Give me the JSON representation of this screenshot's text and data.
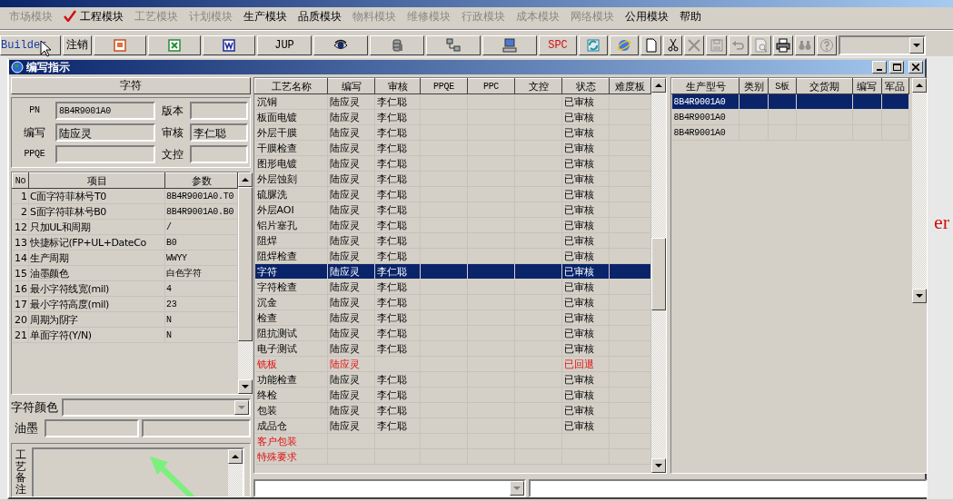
{
  "menu": [
    {
      "label": "市场模块",
      "disabled": true,
      "checked": false
    },
    {
      "label": "工程模块",
      "disabled": false,
      "checked": true
    },
    {
      "label": "工艺模块",
      "disabled": true,
      "checked": false
    },
    {
      "label": "计划模块",
      "disabled": true,
      "checked": false
    },
    {
      "label": "生产模块",
      "disabled": false,
      "checked": false
    },
    {
      "label": "品质模块",
      "disabled": false,
      "checked": false
    },
    {
      "label": "物料模块",
      "disabled": true,
      "checked": false
    },
    {
      "label": "维修模块",
      "disabled": true,
      "checked": false
    },
    {
      "label": "行政模块",
      "disabled": true,
      "checked": false
    },
    {
      "label": "成本模块",
      "disabled": true,
      "checked": false
    },
    {
      "label": "网络模块",
      "disabled": true,
      "checked": false
    },
    {
      "label": "公用模块",
      "disabled": false,
      "checked": false
    },
    {
      "label": "帮助",
      "disabled": false,
      "checked": false
    }
  ],
  "toolbar": [
    {
      "kind": "text",
      "label": "Builder",
      "color": "#1a3aa0"
    },
    {
      "kind": "text",
      "label": "注销",
      "color": "#000000"
    },
    {
      "kind": "icon",
      "disabled": false
    },
    {
      "kind": "icon",
      "disabled": false
    },
    {
      "kind": "icon",
      "disabled": false
    },
    {
      "kind": "text",
      "label": "JUP",
      "color": "#000000"
    },
    {
      "kind": "icon",
      "disabled": false
    },
    {
      "kind": "icon",
      "disabled": false
    },
    {
      "kind": "icon",
      "disabled": false
    },
    {
      "kind": "icon",
      "disabled": false
    },
    {
      "kind": "text",
      "label": "SPC",
      "color": "#d01010"
    },
    {
      "kind": "icon",
      "disabled": false
    },
    {
      "kind": "icon",
      "disabled": false
    },
    {
      "kind": "icon",
      "disabled": false
    },
    {
      "kind": "icon",
      "disabled": false
    },
    {
      "kind": "icon",
      "disabled": true
    },
    {
      "kind": "icon",
      "disabled": true
    },
    {
      "kind": "icon",
      "disabled": true
    },
    {
      "kind": "icon",
      "disabled": true
    },
    {
      "kind": "icon",
      "disabled": false
    },
    {
      "kind": "icon",
      "disabled": true
    },
    {
      "kind": "icon",
      "disabled": true
    },
    {
      "kind": "combo"
    }
  ],
  "window": {
    "title": "编写指示"
  },
  "detail": {
    "header": "字符",
    "fields": [
      {
        "label": "PN",
        "value": "8B4R9001A0"
      },
      {
        "label": "版本"
      },
      {
        "label": "编写",
        "value": "陆应灵"
      },
      {
        "label": "审核",
        "value": "李仁聪"
      },
      {
        "label": "PPQE"
      },
      {
        "label": "文控"
      }
    ],
    "params": {
      "columns": [
        "No",
        "项目",
        "参数"
      ],
      "rows": [
        [
          "1",
          "C面字符菲林号T0",
          "8B4R9001A0.T0"
        ],
        [
          "2",
          "S面字符菲林号B0",
          "8B4R9001A0.B0"
        ],
        [
          "12",
          "只加UL和周期",
          "/"
        ],
        [
          "13",
          "快捷标记(FP+UL+DateCo",
          "B0"
        ],
        [
          "14",
          "生产周期",
          "WWYY"
        ],
        [
          "15",
          "油墨颜色",
          "白色字符"
        ],
        [
          "16",
          "最小字符线宽(mil)",
          "4"
        ],
        [
          "17",
          "最小字符高度(mil)",
          "23"
        ],
        [
          "20",
          "周期为阴字",
          "N"
        ],
        [
          "21",
          "单面字符(Y/N)",
          "N"
        ]
      ]
    },
    "color_label": "字符颜色",
    "ink_label": "油墨",
    "notes_label": "工艺备注"
  },
  "process_table": {
    "columns": [
      "工艺名称",
      "编写",
      "审核",
      "PPQE",
      "PPC",
      "文控",
      "状态",
      "难度板"
    ],
    "rows": [
      {
        "cells": [
          "沉铜",
          "陆应灵",
          "李仁聪",
          "",
          "",
          "",
          "已审核",
          ""
        ],
        "selected": false,
        "alert": false
      },
      {
        "cells": [
          "板面电镀",
          "陆应灵",
          "李仁聪",
          "",
          "",
          "",
          "已审核",
          ""
        ],
        "selected": false,
        "alert": false
      },
      {
        "cells": [
          "外层干膜",
          "陆应灵",
          "李仁聪",
          "",
          "",
          "",
          "已审核",
          ""
        ],
        "selected": false,
        "alert": false
      },
      {
        "cells": [
          "干膜检查",
          "陆应灵",
          "李仁聪",
          "",
          "",
          "",
          "已审核",
          ""
        ],
        "selected": false,
        "alert": false
      },
      {
        "cells": [
          "图形电镀",
          "陆应灵",
          "李仁聪",
          "",
          "",
          "",
          "已审核",
          ""
        ],
        "selected": false,
        "alert": false
      },
      {
        "cells": [
          "外层蚀刻",
          "陆应灵",
          "李仁聪",
          "",
          "",
          "",
          "已审核",
          ""
        ],
        "selected": false,
        "alert": false
      },
      {
        "cells": [
          "硫脲洗",
          "陆应灵",
          "李仁聪",
          "",
          "",
          "",
          "已审核",
          ""
        ],
        "selected": false,
        "alert": false
      },
      {
        "cells": [
          "外层AOI",
          "陆应灵",
          "李仁聪",
          "",
          "",
          "",
          "已审核",
          ""
        ],
        "selected": false,
        "alert": false
      },
      {
        "cells": [
          "铝片塞孔",
          "陆应灵",
          "李仁聪",
          "",
          "",
          "",
          "已审核",
          ""
        ],
        "selected": false,
        "alert": false
      },
      {
        "cells": [
          "阻焊",
          "陆应灵",
          "李仁聪",
          "",
          "",
          "",
          "已审核",
          ""
        ],
        "selected": false,
        "alert": false
      },
      {
        "cells": [
          "阻焊检查",
          "陆应灵",
          "李仁聪",
          "",
          "",
          "",
          "已审核",
          ""
        ],
        "selected": false,
        "alert": false
      },
      {
        "cells": [
          "字符",
          "陆应灵",
          "李仁聪",
          "",
          "",
          "",
          "已审核",
          ""
        ],
        "selected": true,
        "alert": false
      },
      {
        "cells": [
          "字符检查",
          "陆应灵",
          "李仁聪",
          "",
          "",
          "",
          "已审核",
          ""
        ],
        "selected": false,
        "alert": false
      },
      {
        "cells": [
          "沉金",
          "陆应灵",
          "李仁聪",
          "",
          "",
          "",
          "已审核",
          ""
        ],
        "selected": false,
        "alert": false
      },
      {
        "cells": [
          "检查",
          "陆应灵",
          "李仁聪",
          "",
          "",
          "",
          "已审核",
          ""
        ],
        "selected": false,
        "alert": false
      },
      {
        "cells": [
          "阻抗测试",
          "陆应灵",
          "李仁聪",
          "",
          "",
          "",
          "已审核",
          ""
        ],
        "selected": false,
        "alert": false
      },
      {
        "cells": [
          "电子测试",
          "陆应灵",
          "李仁聪",
          "",
          "",
          "",
          "已审核",
          ""
        ],
        "selected": false,
        "alert": false
      },
      {
        "cells": [
          "铣板",
          "陆应灵",
          "",
          "",
          "",
          "",
          "已回退",
          ""
        ],
        "selected": false,
        "alert": true
      },
      {
        "cells": [
          "功能检查",
          "陆应灵",
          "李仁聪",
          "",
          "",
          "",
          "已审核",
          ""
        ],
        "selected": false,
        "alert": false
      },
      {
        "cells": [
          "终检",
          "陆应灵",
          "李仁聪",
          "",
          "",
          "",
          "已审核",
          ""
        ],
        "selected": false,
        "alert": false
      },
      {
        "cells": [
          "包装",
          "陆应灵",
          "李仁聪",
          "",
          "",
          "",
          "已审核",
          ""
        ],
        "selected": false,
        "alert": false
      },
      {
        "cells": [
          "成品仓",
          "陆应灵",
          "李仁聪",
          "",
          "",
          "",
          "已审核",
          ""
        ],
        "selected": false,
        "alert": false
      },
      {
        "cells": [
          "客户包装",
          "",
          "",
          "",
          "",
          "",
          "",
          ""
        ],
        "selected": false,
        "alert": true
      },
      {
        "cells": [
          "特殊要求",
          "",
          "",
          "",
          "",
          "",
          "",
          ""
        ],
        "selected": false,
        "alert": true
      }
    ]
  },
  "model_table": {
    "columns": [
      "生产型号",
      "类别",
      "S板",
      "交货期",
      "编写",
      "军品"
    ],
    "rows": [
      {
        "cells": [
          "8B4R9001A0",
          "",
          "",
          "",
          "",
          ""
        ],
        "selected": true
      },
      {
        "cells": [
          "8B4R9001A0",
          "",
          "",
          "",
          "",
          ""
        ],
        "selected": false
      },
      {
        "cells": [
          "8B4R9001A0",
          "",
          "",
          "",
          "",
          ""
        ],
        "selected": false
      }
    ]
  },
  "background_text": "er"
}
